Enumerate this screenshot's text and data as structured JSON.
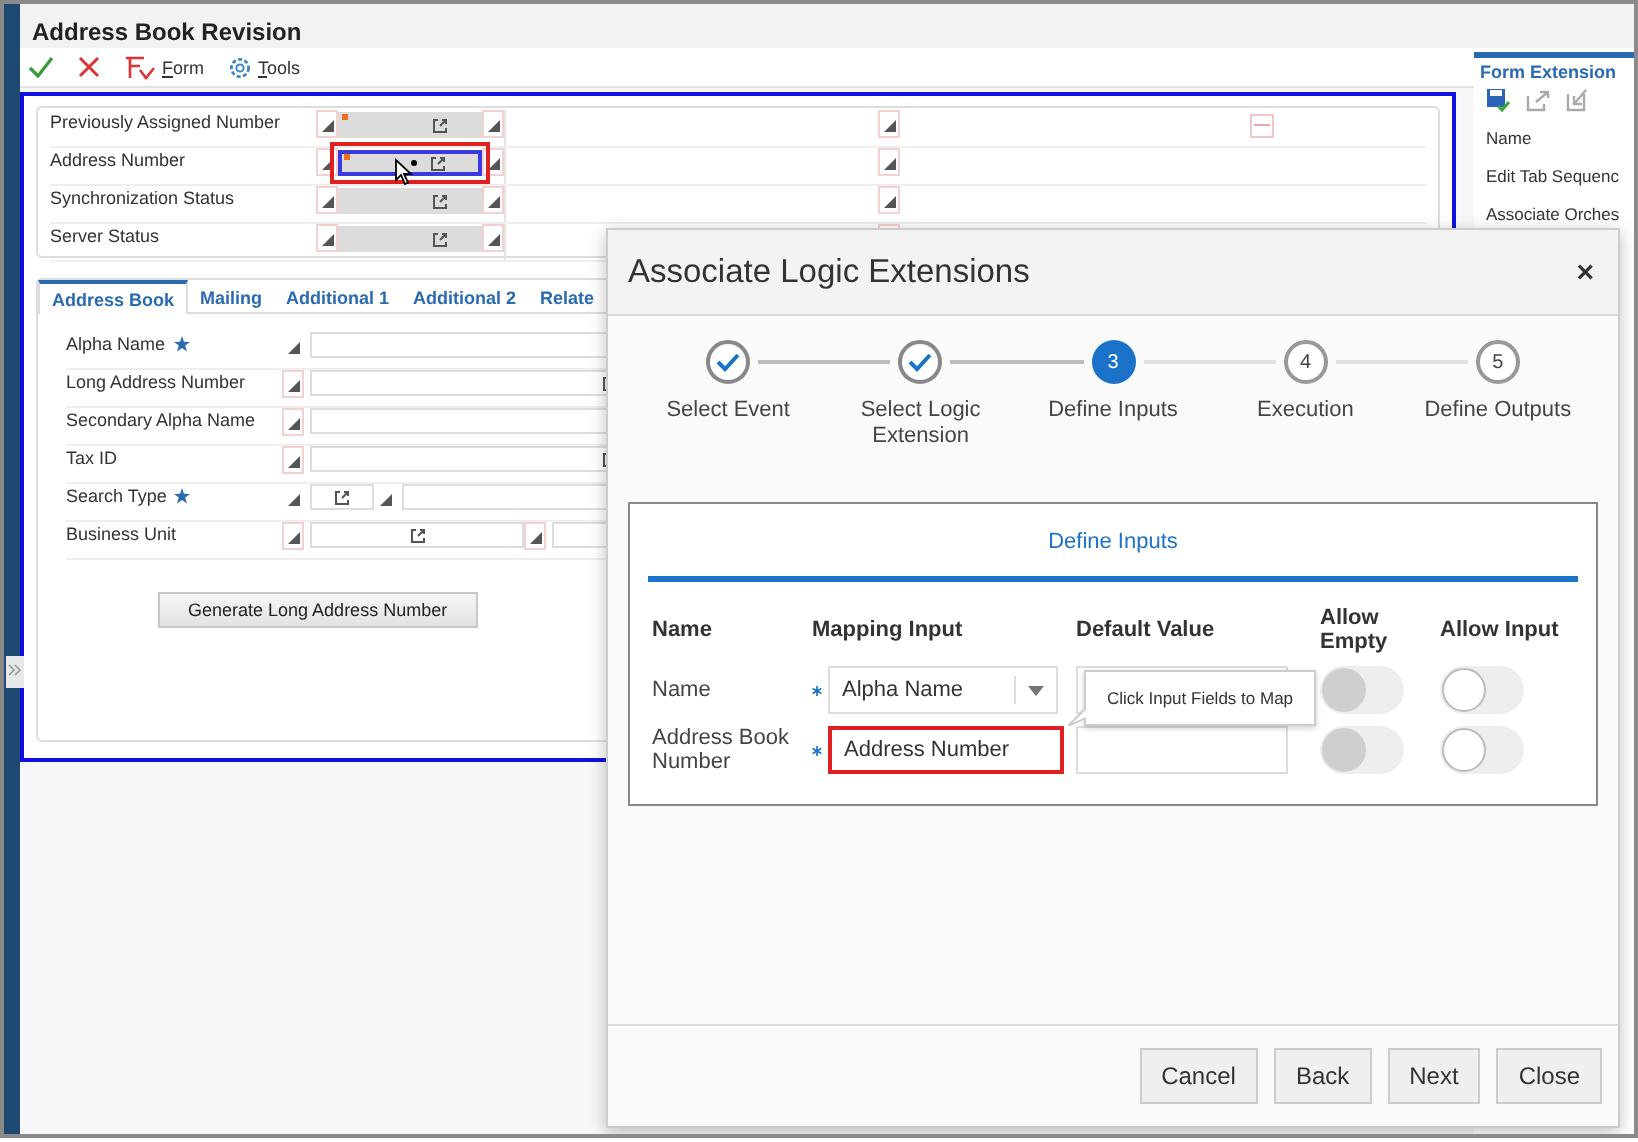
{
  "window": {
    "title": "Address Book Revision"
  },
  "toolbar": [
    {
      "kind": "ok"
    },
    {
      "kind": "cancel"
    },
    {
      "kind": "form",
      "label": "Form"
    },
    {
      "kind": "tools",
      "label": "Tools"
    }
  ],
  "header_fields": [
    {
      "label": "Previously Assigned Number",
      "marked": true,
      "highlighted": false,
      "hovered": false
    },
    {
      "label": "Address Number",
      "marked": true,
      "highlighted": true,
      "hovered": true
    },
    {
      "label": "Synchronization Status",
      "marked": false,
      "highlighted": false,
      "hovered": false
    },
    {
      "label": "Server Status",
      "marked": false,
      "highlighted": false,
      "hovered": false
    }
  ],
  "tabs": [
    {
      "label": "Address Book",
      "selected": true
    },
    {
      "label": "Mailing",
      "selected": false
    },
    {
      "label": "Additional 1",
      "selected": false
    },
    {
      "label": "Additional 2",
      "selected": false
    },
    {
      "label": "Relate",
      "selected": false
    }
  ],
  "fields": [
    {
      "label": "Alpha Name",
      "required": true,
      "kind": "text"
    },
    {
      "label": "Long Address Number",
      "required": false,
      "kind": "lookup"
    },
    {
      "label": "Secondary Alpha Name",
      "required": false,
      "kind": "text"
    },
    {
      "label": "Tax ID",
      "required": false,
      "kind": "lookup"
    },
    {
      "label": "Search Type",
      "required": true,
      "kind": "short-lookup"
    },
    {
      "label": "Business Unit",
      "required": false,
      "kind": "unit-lookup"
    }
  ],
  "generate_button": "Generate Long Address Number",
  "right_panel": {
    "title": "Form Extension",
    "items": [
      "Name",
      "Edit Tab Sequenc",
      "Associate Orches"
    ]
  },
  "dialog": {
    "title": "Associate Logic Extensions",
    "close": "×",
    "steps": [
      {
        "label": "Select Event",
        "kind": "done"
      },
      {
        "label": "Select Logic Extension",
        "kind": "done"
      },
      {
        "number": "3",
        "label": "Define Inputs",
        "kind": "current"
      },
      {
        "number": "4",
        "label": "Execution",
        "kind": "todo"
      },
      {
        "number": "5",
        "label": "Define Outputs",
        "kind": "todo"
      }
    ],
    "section_title": "Define Inputs",
    "columns": [
      "Name",
      "Mapping Input",
      "Default Value",
      "Allow Empty",
      "Allow Input"
    ],
    "rows": [
      {
        "name": "Name",
        "required": true,
        "mapping": "Alpha Name",
        "kind": "dropdown",
        "highlighted": false,
        "allow_empty": {
          "on": false,
          "disabled": true
        },
        "allow_input": {
          "on": false,
          "disabled": false
        }
      },
      {
        "name": "Address Book Number",
        "required": true,
        "mapping": "Address Number",
        "kind": "text",
        "highlighted": true,
        "allow_empty": {
          "on": false,
          "disabled": true
        },
        "allow_input": {
          "on": false,
          "disabled": false
        }
      }
    ],
    "tooltip": "Click Input Fields to Map",
    "buttons": [
      "Cancel",
      "Back",
      "Next",
      "Close"
    ]
  }
}
